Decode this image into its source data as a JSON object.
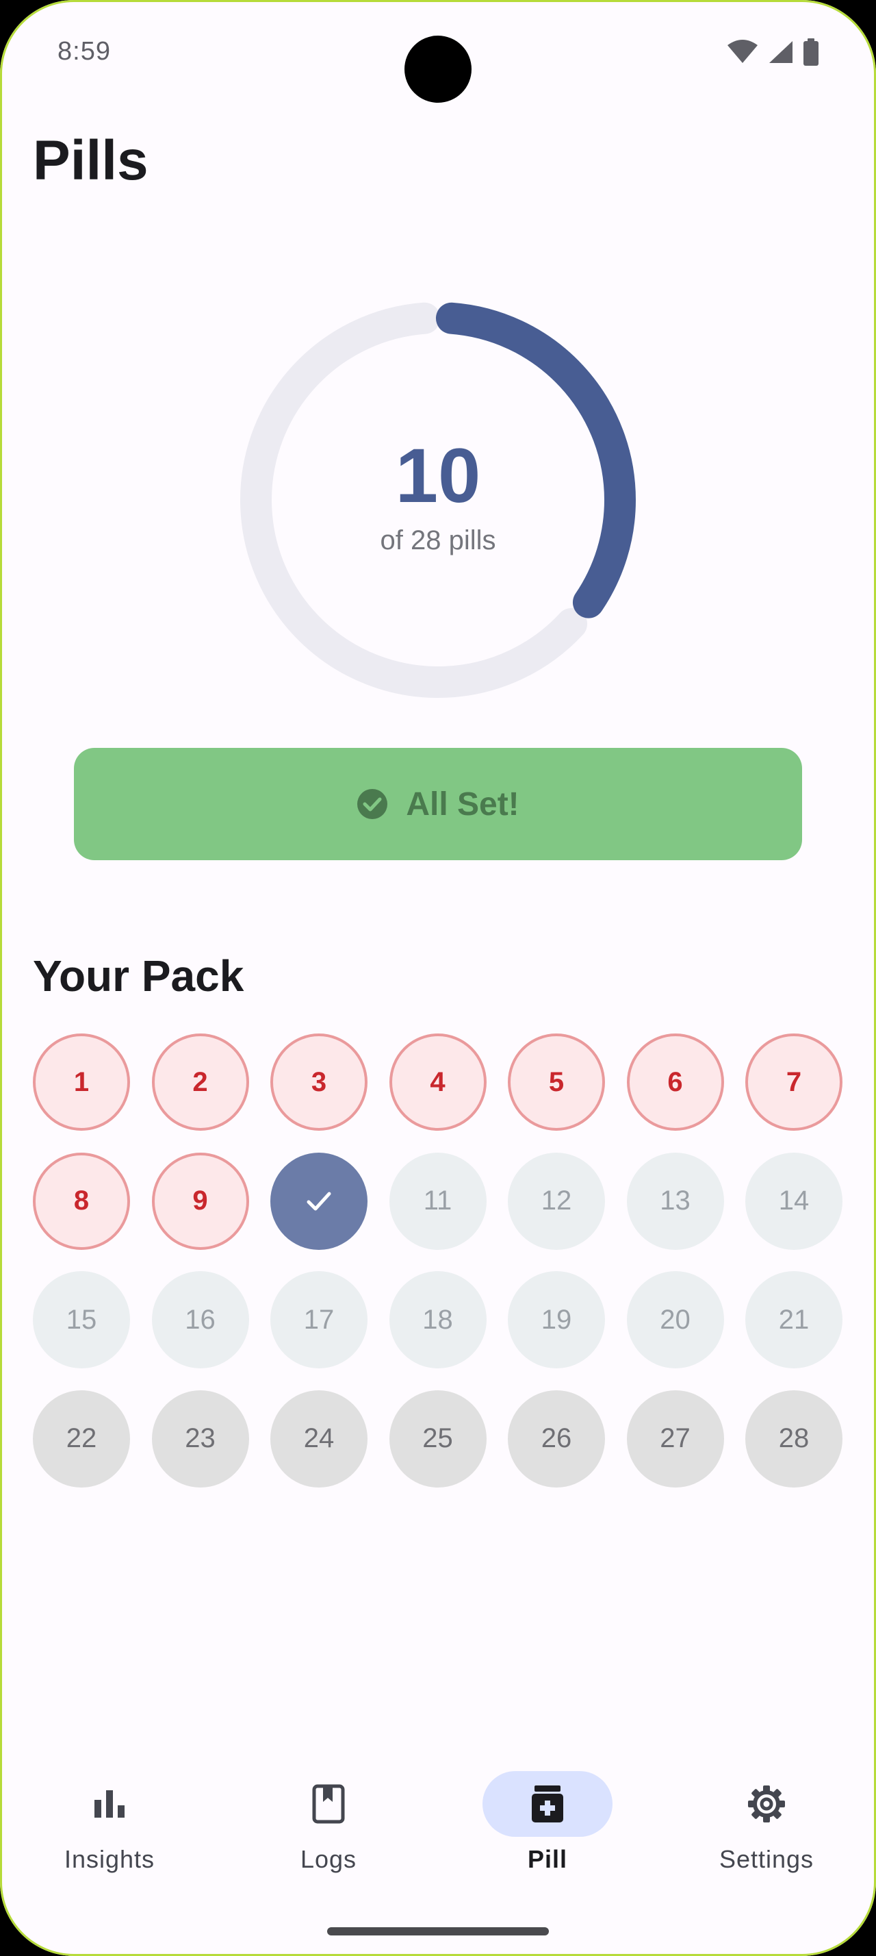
{
  "status_bar": {
    "time": "8:59"
  },
  "page": {
    "title": "Pills"
  },
  "progress": {
    "count": "10",
    "subtitle": "of 28 pills",
    "taken_fraction": 0.357
  },
  "action": {
    "label": "All Set!",
    "icon": "check-circle-icon",
    "color": "#81C784"
  },
  "pack": {
    "title": "Your Pack",
    "pills": [
      {
        "label": "1",
        "state": "missed"
      },
      {
        "label": "2",
        "state": "missed"
      },
      {
        "label": "3",
        "state": "missed"
      },
      {
        "label": "4",
        "state": "missed"
      },
      {
        "label": "5",
        "state": "missed"
      },
      {
        "label": "6",
        "state": "missed"
      },
      {
        "label": "7",
        "state": "missed"
      },
      {
        "label": "8",
        "state": "missed"
      },
      {
        "label": "9",
        "state": "missed"
      },
      {
        "label": "",
        "state": "taken"
      },
      {
        "label": "11",
        "state": "upcoming"
      },
      {
        "label": "12",
        "state": "upcoming"
      },
      {
        "label": "13",
        "state": "upcoming"
      },
      {
        "label": "14",
        "state": "upcoming"
      },
      {
        "label": "15",
        "state": "upcoming"
      },
      {
        "label": "16",
        "state": "upcoming"
      },
      {
        "label": "17",
        "state": "upcoming"
      },
      {
        "label": "18",
        "state": "upcoming"
      },
      {
        "label": "19",
        "state": "upcoming"
      },
      {
        "label": "20",
        "state": "upcoming"
      },
      {
        "label": "21",
        "state": "upcoming"
      },
      {
        "label": "22",
        "state": "placebo"
      },
      {
        "label": "23",
        "state": "placebo"
      },
      {
        "label": "24",
        "state": "placebo"
      },
      {
        "label": "25",
        "state": "placebo"
      },
      {
        "label": "26",
        "state": "placebo"
      },
      {
        "label": "27",
        "state": "placebo"
      },
      {
        "label": "28",
        "state": "placebo"
      }
    ]
  },
  "nav": {
    "items": [
      {
        "label": "Insights",
        "icon": "bar-chart-icon",
        "active": false
      },
      {
        "label": "Logs",
        "icon": "bookmark-book-icon",
        "active": false
      },
      {
        "label": "Pill",
        "icon": "medication-icon",
        "active": true
      },
      {
        "label": "Settings",
        "icon": "gear-icon",
        "active": false
      }
    ]
  },
  "colors": {
    "accent": "#485D93",
    "ring_track": "#ECEBF2",
    "missed_bg": "#FDE8EA",
    "missed_text": "#C9272D",
    "taken_bg": "#6B7CA8",
    "nav_active_bg": "#DAE2FF"
  }
}
